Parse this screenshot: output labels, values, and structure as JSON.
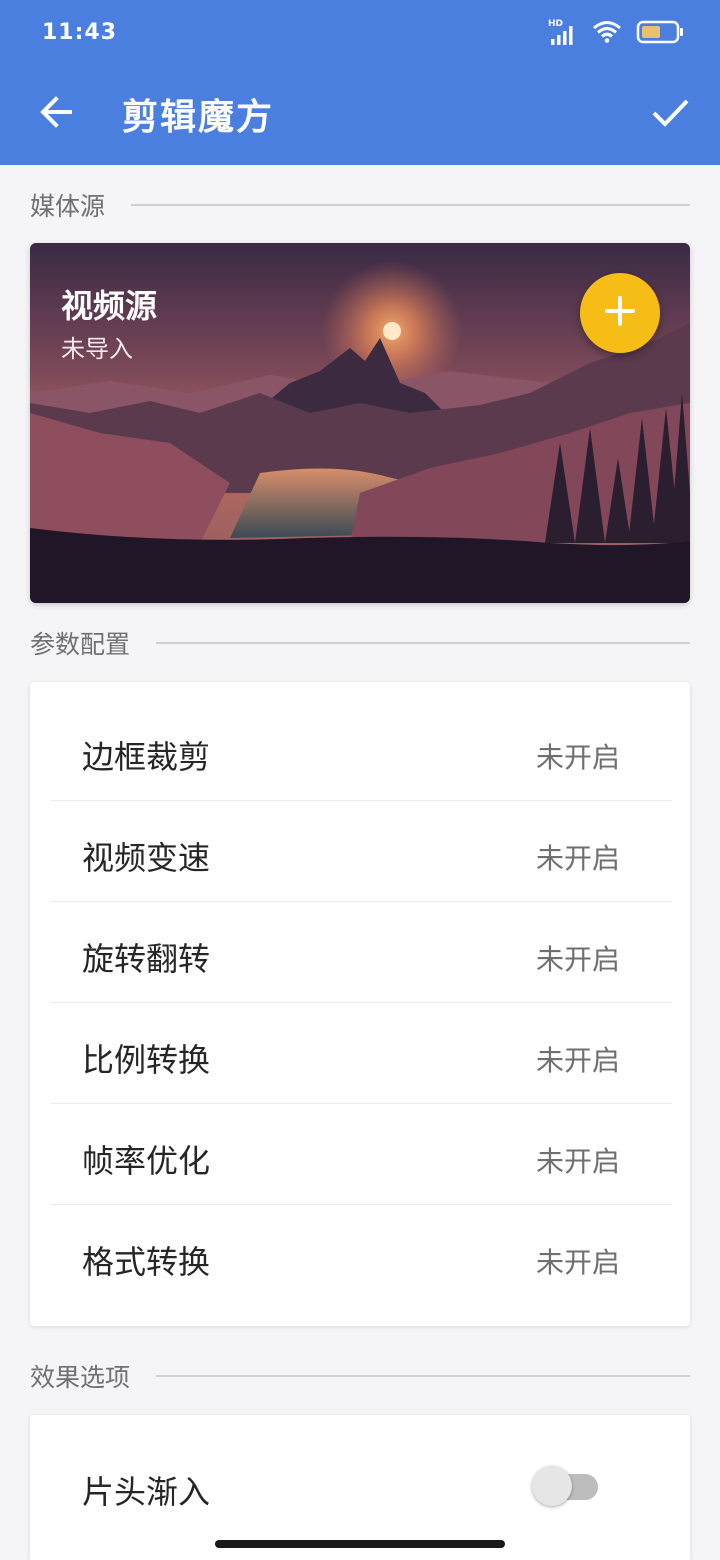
{
  "status_bar": {
    "time": "11:43",
    "signal_label": "HD",
    "icons": [
      "signal-icon",
      "wifi-icon",
      "battery-icon"
    ]
  },
  "app_bar": {
    "title": "剪辑魔方",
    "back_icon": "arrow-left-icon",
    "confirm_icon": "check-icon",
    "color": "#4a7fe0"
  },
  "sections": {
    "media": "媒体源",
    "params": "参数配置",
    "effects": "效果选项"
  },
  "media_card": {
    "title": "视频源",
    "subtitle": "未导入",
    "add_icon": "plus-icon",
    "fab_color": "#f6bd16"
  },
  "params": [
    {
      "name": "边框裁剪",
      "value": "未开启"
    },
    {
      "name": "视频变速",
      "value": "未开启"
    },
    {
      "name": "旋转翻转",
      "value": "未开启"
    },
    {
      "name": "比例转换",
      "value": "未开启"
    },
    {
      "name": "帧率优化",
      "value": "未开启"
    },
    {
      "name": "格式转换",
      "value": "未开启"
    }
  ],
  "effects": [
    {
      "name": "片头渐入",
      "enabled": false
    }
  ]
}
